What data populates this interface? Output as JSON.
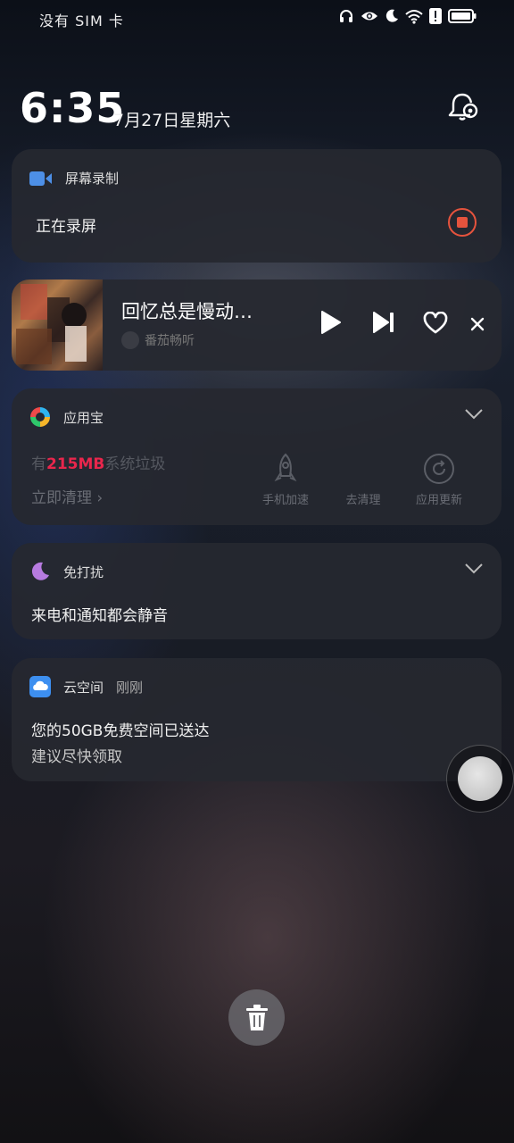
{
  "status_bar": {
    "carrier": "没有 SIM 卡",
    "icons": [
      "headphones-icon",
      "eye-icon",
      "moon-icon",
      "wifi-icon",
      "alert-icon",
      "battery-icon"
    ]
  },
  "lockscreen": {
    "time": "6:35",
    "date": "7月27日星期六"
  },
  "notifications": {
    "screen_record": {
      "app": "屏幕录制",
      "text": "正在录屏",
      "accent": "#e5533d"
    },
    "music": {
      "title": "回忆总是慢动…",
      "source": "番茄畅听"
    },
    "app_store": {
      "app": "应用宝",
      "junk_prefix": "有",
      "junk_size": "215MB",
      "junk_suffix": "系统垃圾",
      "junk_color": "#e8264c",
      "clean_now": "立即清理 ›",
      "actions": [
        "手机加速",
        "去清理",
        "应用更新"
      ]
    },
    "dnd": {
      "app": "免打扰",
      "text": "来电和通知都会静音"
    },
    "cloud": {
      "app": "云空间",
      "time": "刚刚",
      "line1": "您的50GB免费空间已送达",
      "line2": "建议尽快领取"
    }
  }
}
